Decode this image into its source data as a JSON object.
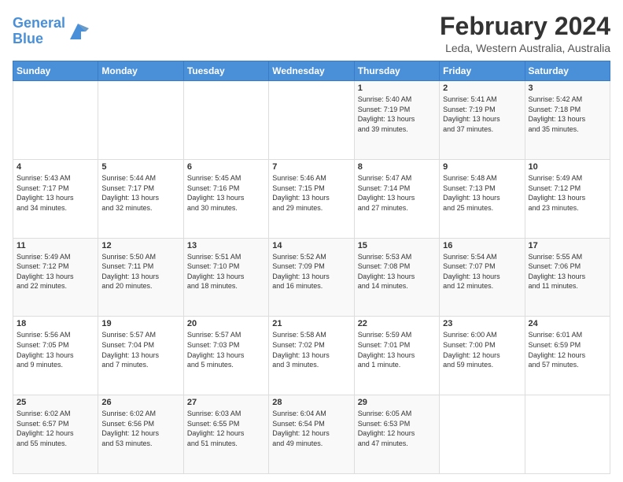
{
  "logo": {
    "line1": "General",
    "line2": "Blue"
  },
  "header": {
    "month_title": "February 2024",
    "location": "Leda, Western Australia, Australia"
  },
  "days_of_week": [
    "Sunday",
    "Monday",
    "Tuesday",
    "Wednesday",
    "Thursday",
    "Friday",
    "Saturday"
  ],
  "weeks": [
    [
      {
        "day": "",
        "info": ""
      },
      {
        "day": "",
        "info": ""
      },
      {
        "day": "",
        "info": ""
      },
      {
        "day": "",
        "info": ""
      },
      {
        "day": "1",
        "info": "Sunrise: 5:40 AM\nSunset: 7:19 PM\nDaylight: 13 hours\nand 39 minutes."
      },
      {
        "day": "2",
        "info": "Sunrise: 5:41 AM\nSunset: 7:19 PM\nDaylight: 13 hours\nand 37 minutes."
      },
      {
        "day": "3",
        "info": "Sunrise: 5:42 AM\nSunset: 7:18 PM\nDaylight: 13 hours\nand 35 minutes."
      }
    ],
    [
      {
        "day": "4",
        "info": "Sunrise: 5:43 AM\nSunset: 7:17 PM\nDaylight: 13 hours\nand 34 minutes."
      },
      {
        "day": "5",
        "info": "Sunrise: 5:44 AM\nSunset: 7:17 PM\nDaylight: 13 hours\nand 32 minutes."
      },
      {
        "day": "6",
        "info": "Sunrise: 5:45 AM\nSunset: 7:16 PM\nDaylight: 13 hours\nand 30 minutes."
      },
      {
        "day": "7",
        "info": "Sunrise: 5:46 AM\nSunset: 7:15 PM\nDaylight: 13 hours\nand 29 minutes."
      },
      {
        "day": "8",
        "info": "Sunrise: 5:47 AM\nSunset: 7:14 PM\nDaylight: 13 hours\nand 27 minutes."
      },
      {
        "day": "9",
        "info": "Sunrise: 5:48 AM\nSunset: 7:13 PM\nDaylight: 13 hours\nand 25 minutes."
      },
      {
        "day": "10",
        "info": "Sunrise: 5:49 AM\nSunset: 7:12 PM\nDaylight: 13 hours\nand 23 minutes."
      }
    ],
    [
      {
        "day": "11",
        "info": "Sunrise: 5:49 AM\nSunset: 7:12 PM\nDaylight: 13 hours\nand 22 minutes."
      },
      {
        "day": "12",
        "info": "Sunrise: 5:50 AM\nSunset: 7:11 PM\nDaylight: 13 hours\nand 20 minutes."
      },
      {
        "day": "13",
        "info": "Sunrise: 5:51 AM\nSunset: 7:10 PM\nDaylight: 13 hours\nand 18 minutes."
      },
      {
        "day": "14",
        "info": "Sunrise: 5:52 AM\nSunset: 7:09 PM\nDaylight: 13 hours\nand 16 minutes."
      },
      {
        "day": "15",
        "info": "Sunrise: 5:53 AM\nSunset: 7:08 PM\nDaylight: 13 hours\nand 14 minutes."
      },
      {
        "day": "16",
        "info": "Sunrise: 5:54 AM\nSunset: 7:07 PM\nDaylight: 13 hours\nand 12 minutes."
      },
      {
        "day": "17",
        "info": "Sunrise: 5:55 AM\nSunset: 7:06 PM\nDaylight: 13 hours\nand 11 minutes."
      }
    ],
    [
      {
        "day": "18",
        "info": "Sunrise: 5:56 AM\nSunset: 7:05 PM\nDaylight: 13 hours\nand 9 minutes."
      },
      {
        "day": "19",
        "info": "Sunrise: 5:57 AM\nSunset: 7:04 PM\nDaylight: 13 hours\nand 7 minutes."
      },
      {
        "day": "20",
        "info": "Sunrise: 5:57 AM\nSunset: 7:03 PM\nDaylight: 13 hours\nand 5 minutes."
      },
      {
        "day": "21",
        "info": "Sunrise: 5:58 AM\nSunset: 7:02 PM\nDaylight: 13 hours\nand 3 minutes."
      },
      {
        "day": "22",
        "info": "Sunrise: 5:59 AM\nSunset: 7:01 PM\nDaylight: 13 hours\nand 1 minute."
      },
      {
        "day": "23",
        "info": "Sunrise: 6:00 AM\nSunset: 7:00 PM\nDaylight: 12 hours\nand 59 minutes."
      },
      {
        "day": "24",
        "info": "Sunrise: 6:01 AM\nSunset: 6:59 PM\nDaylight: 12 hours\nand 57 minutes."
      }
    ],
    [
      {
        "day": "25",
        "info": "Sunrise: 6:02 AM\nSunset: 6:57 PM\nDaylight: 12 hours\nand 55 minutes."
      },
      {
        "day": "26",
        "info": "Sunrise: 6:02 AM\nSunset: 6:56 PM\nDaylight: 12 hours\nand 53 minutes."
      },
      {
        "day": "27",
        "info": "Sunrise: 6:03 AM\nSunset: 6:55 PM\nDaylight: 12 hours\nand 51 minutes."
      },
      {
        "day": "28",
        "info": "Sunrise: 6:04 AM\nSunset: 6:54 PM\nDaylight: 12 hours\nand 49 minutes."
      },
      {
        "day": "29",
        "info": "Sunrise: 6:05 AM\nSunset: 6:53 PM\nDaylight: 12 hours\nand 47 minutes."
      },
      {
        "day": "",
        "info": ""
      },
      {
        "day": "",
        "info": ""
      }
    ]
  ]
}
